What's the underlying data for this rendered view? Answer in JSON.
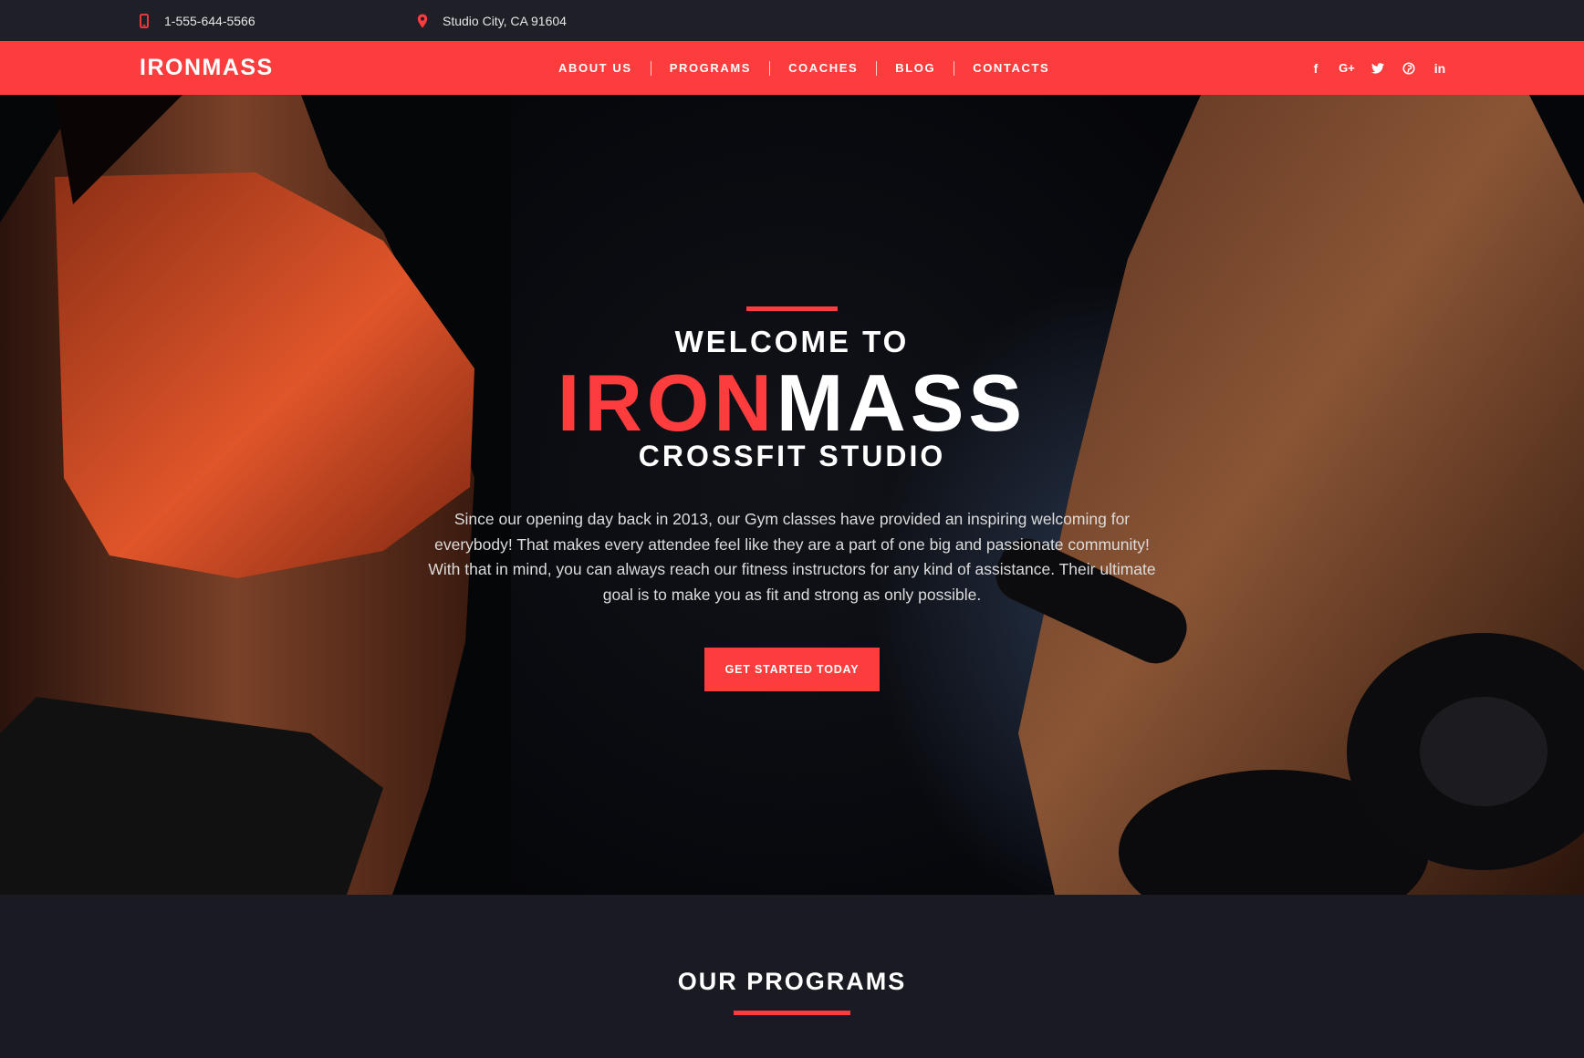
{
  "topbar": {
    "phone": "1-555-644-5566",
    "location": "Studio City, CA 91604",
    "phone_icon": "phone-icon",
    "location_icon": "map-pin-icon"
  },
  "nav": {
    "logo": "IRONMASS",
    "items": [
      {
        "label": "ABOUT US"
      },
      {
        "label": "PROGRAMS"
      },
      {
        "label": "COACHES"
      },
      {
        "label": "BLOG"
      },
      {
        "label": "CONTACTS"
      }
    ],
    "social": [
      {
        "icon": "facebook-icon",
        "glyph": "f"
      },
      {
        "icon": "google-plus-icon",
        "glyph": "G+"
      },
      {
        "icon": "twitter-icon",
        "glyph": ""
      },
      {
        "icon": "pinterest-icon",
        "glyph": ""
      },
      {
        "icon": "linkedin-icon",
        "glyph": "in"
      }
    ]
  },
  "hero": {
    "welcome": "WELCOME TO",
    "brand_red": "IRON",
    "brand_white": "MASS",
    "subtitle": "CROSSFIT STUDIO",
    "intro": "Since our opening day back in 2013, our Gym classes have provided an inspiring welcoming for everybody! That makes every attendee feel like they are a part of one big and passionate community! With that in mind, you can always reach our fitness instructors for any kind of assistance. Their ultimate goal is to make you as fit and strong as only possible.",
    "cta": "GET STARTED TODAY"
  },
  "programs": {
    "title": "OUR PROGRAMS"
  },
  "colors": {
    "accent": "#fd3c3d",
    "topbar_bg": "#1e1f27",
    "page_bg": "#1a1b22"
  }
}
